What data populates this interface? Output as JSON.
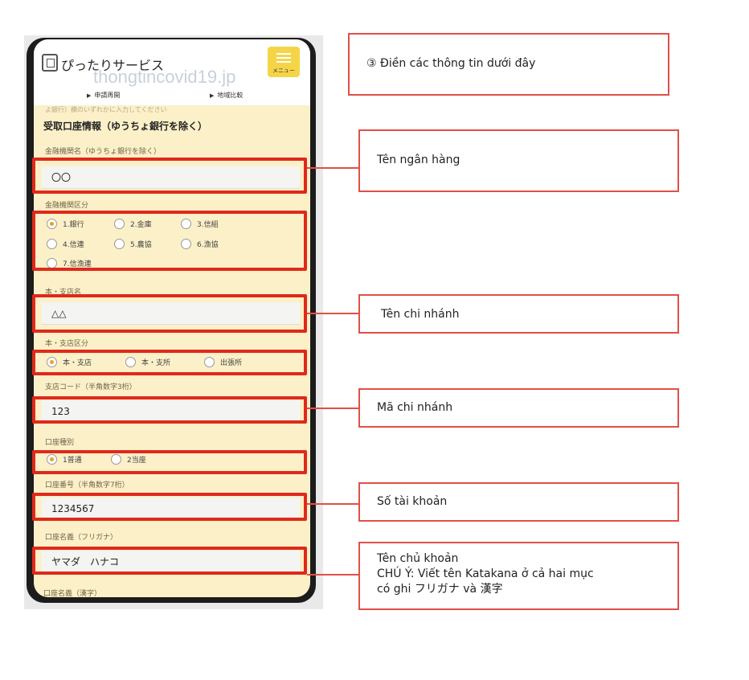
{
  "phone": {
    "app_title": "ぴったりサービス",
    "watermark": "thongtincovid19.jp",
    "menu_label": "メニュー",
    "nav": [
      "申請再開",
      "地域比較"
    ],
    "faded_text": "よ銀行）欄のいずれかに入力してください",
    "section_title": "受取口座情報（ゆうちょ銀行を除く）",
    "bank_name": {
      "label": "金融機関名（ゆうちょ銀行を除く）",
      "value": "〇〇"
    },
    "bank_type": {
      "label": "金融機関区分",
      "options": [
        "1.銀行",
        "2.金庫",
        "3.信組",
        "4.信連",
        "5.農協",
        "6.漁協",
        "7.信漁連"
      ],
      "selected": "1.銀行"
    },
    "branch_name": {
      "label": "本・支店名",
      "value": "△△"
    },
    "branch_type": {
      "label": "本・支店区分",
      "options": [
        "本・支店",
        "本・支所",
        "出張所"
      ],
      "selected": "本・支店"
    },
    "branch_code": {
      "label": "支店コード（半角数字3桁）",
      "value": "123"
    },
    "account_type": {
      "label": "口座種別",
      "options": [
        "1普通",
        "2当座"
      ],
      "selected": "1普通"
    },
    "account_number": {
      "label": "口座番号（半角数字7桁）",
      "value": "1234567"
    },
    "holder_kana": {
      "label": "口座名義（フリガナ）",
      "value": "ヤマダ　ハナコ"
    },
    "holder_kanji_label": "口座名義（漢字）"
  },
  "callouts": {
    "step": "③ Điền các thông tin dưới đây",
    "bank_name": "Tên ngân hàng",
    "branch_name": "Tên chi nhánh",
    "branch_code": "Mã chi nhánh",
    "account_number": "Số tài khoản",
    "holder": [
      "Tên chủ khoản",
      "CHÚ Ý: Viết tên Katakana ở cả hai mục",
      "có ghi フリガナ và 漢字"
    ]
  },
  "colors": {
    "highlight": "#e0291b",
    "screen_bg": "#fbf0c8",
    "menu_button": "#f5d547",
    "radio_selected": "#f0a020"
  }
}
